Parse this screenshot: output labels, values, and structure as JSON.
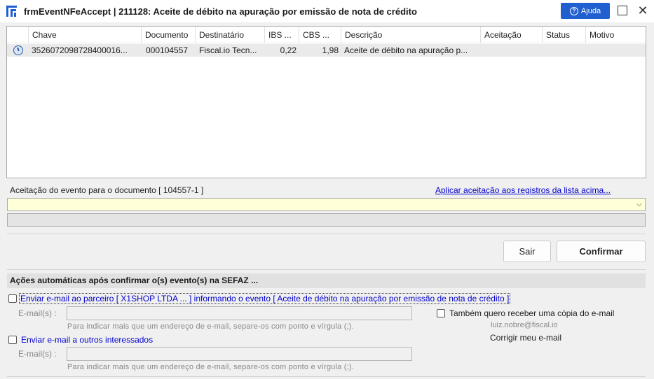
{
  "window": {
    "title": "frmEventNFeAccept | 211128: Aceite de débito na apuração por emissão de nota de crédito",
    "help_label": "Ajuda"
  },
  "grid": {
    "columns": [
      "Chave",
      "Documento",
      "Destinatário",
      "IBS ...",
      "CBS ...",
      "Descrição",
      "Aceitação",
      "Status",
      "Motivo"
    ],
    "rows": [
      {
        "chave": "3526072098728400016...",
        "documento": "000104557",
        "destinatario": "Fiscal.io Tecn...",
        "ibs": "0,22",
        "cbs": "1,98",
        "descricao": "Aceite de débito na apuração p...",
        "aceitacao": "",
        "status": "",
        "motivo": ""
      }
    ]
  },
  "acceptance": {
    "label": "Aceitação do evento para o documento [ 104557-1 ]",
    "apply_link": "Aplicar aceitação aos registros da lista acima...",
    "selected_value": ""
  },
  "buttons": {
    "exit": "Sair",
    "confirm": "Confirmar"
  },
  "auto_actions": {
    "header": "Ações automáticas após confirmar o(s) evento(s) na SEFAZ ...",
    "partner_email_option": "Enviar e-mail ao parceiro [ X1SHOP LTDA ... ] informando o evento [ Aceite de débito na apuração por emissão de nota de crédito ]",
    "email_label": "E-mail(s) :",
    "email_hint": "Para indicar mais que um endereço de e-mail, separe-os com ponto e vírgula (;).",
    "copy_option": "Também quero receber uma cópia do e-mail",
    "user_email": "luiz.nobre@fiscal.io",
    "correct_email_link": "Corrigir meu e-mail",
    "others_email_option": "Enviar e-mail a outros interessados"
  },
  "colors": {
    "accent": "#1f5fd0",
    "link": "#0000cc",
    "combo_bg": "#ffffd8"
  }
}
